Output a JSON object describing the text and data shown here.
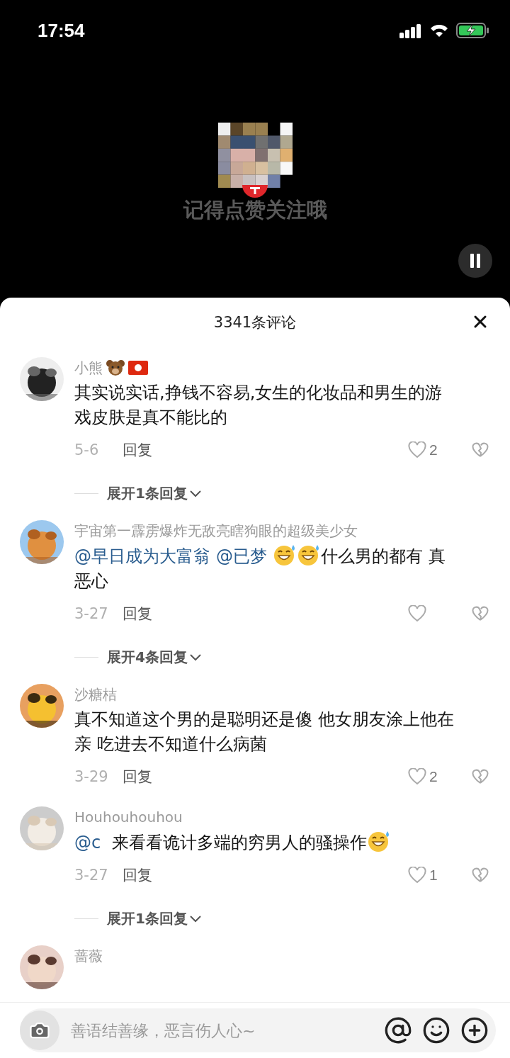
{
  "status_bar": {
    "time": "17:54"
  },
  "video": {
    "caption": "记得点赞关注哦",
    "paused": true
  },
  "comments_sheet": {
    "title": "3341条评论",
    "comments": [
      {
        "name": "小熊",
        "badges": [
          {
            "kind": "bear"
          },
          {
            "kind": "flag"
          }
        ],
        "body": [
          {
            "kind": "text",
            "text": "其实说实话,挣钱不容易,女生的化妆品和男生的游戏皮肤是真不能比的"
          }
        ],
        "date": "5-6",
        "reply": "回复",
        "likes": "2",
        "expand": "展开1条回复"
      },
      {
        "name": "宇宙第一霹雳爆炸无敌亮瞎狗眼的超级美少女",
        "body": [
          {
            "kind": "mention",
            "text": "@早日成为大富翁"
          },
          {
            "kind": "mention",
            "text": "@已梦"
          },
          {
            "kind": "emoji"
          },
          {
            "kind": "emoji"
          },
          {
            "kind": "text",
            "text": "什么男的都有 真恶心"
          }
        ],
        "date": "3-27",
        "reply": "回复",
        "expand": "展开4条回复"
      },
      {
        "name": "沙糖桔",
        "body": [
          {
            "kind": "text",
            "text": "真不知道这个男的是聪明还是傻 他女朋友涂上他在亲 吃进去不知道什么病菌"
          }
        ],
        "date": "3-29",
        "reply": "回复",
        "likes": "2"
      },
      {
        "name": "Houhouhouhou",
        "body": [
          {
            "kind": "mention",
            "text": "@c"
          },
          {
            "kind": "text",
            "text": " 来看看诡计多端的穷男人的骚操作"
          },
          {
            "kind": "emoji"
          }
        ],
        "date": "3-27",
        "reply": "回复",
        "likes": "1",
        "expand": "展开1条回复"
      },
      {
        "name": "蔷薇"
      }
    ]
  },
  "composer": {
    "placeholder": "善语结善缘，恶言伤人心~"
  }
}
